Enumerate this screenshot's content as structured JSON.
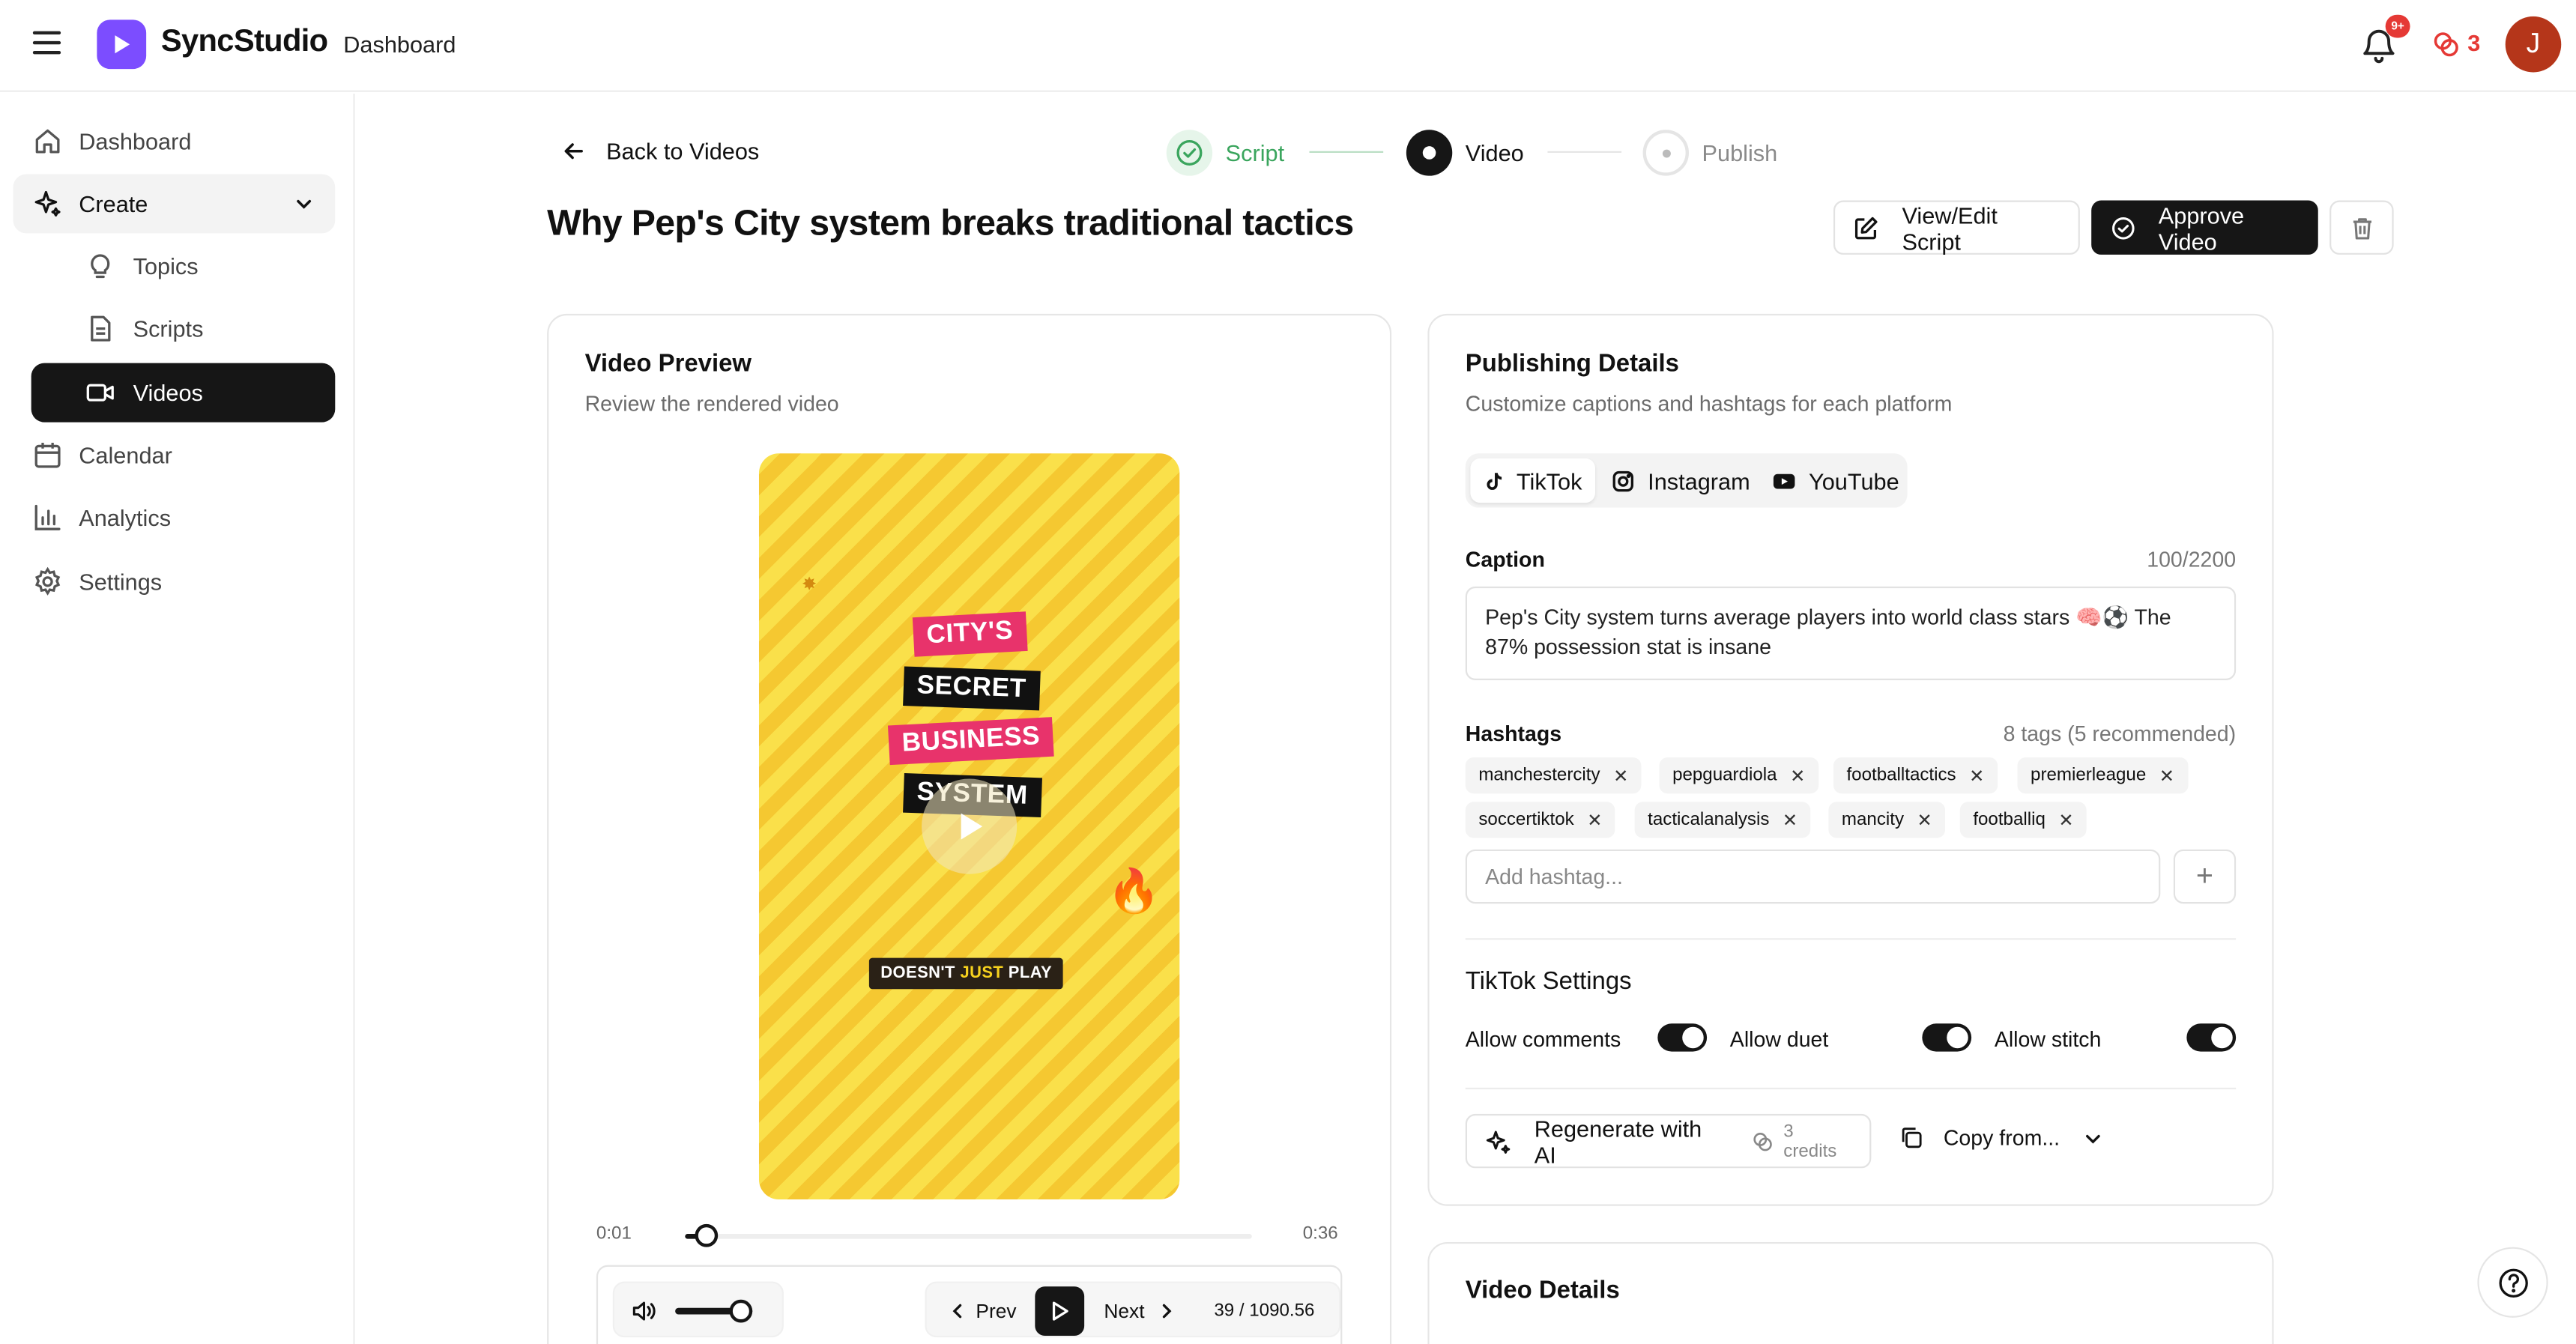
{
  "app": {
    "brand": "SyncStudio",
    "breadcrumb": "Dashboard"
  },
  "header": {
    "notification_badge": "9+",
    "credits": "3",
    "avatar_initial": "J"
  },
  "colors": {
    "brand": "#7c4dff",
    "dark": "#161616",
    "alert": "#e53935",
    "success": "#3aa55d",
    "avatar": "#b5361a"
  },
  "sidebar": {
    "items": [
      {
        "label": "Dashboard",
        "icon": "home-icon"
      },
      {
        "label": "Create",
        "icon": "sparkles-icon"
      },
      {
        "label": "Topics",
        "icon": "lightbulb-icon"
      },
      {
        "label": "Scripts",
        "icon": "file-icon"
      },
      {
        "label": "Videos",
        "icon": "video-icon"
      },
      {
        "label": "Calendar",
        "icon": "calendar-icon"
      },
      {
        "label": "Analytics",
        "icon": "chart-icon"
      },
      {
        "label": "Settings",
        "icon": "gear-icon"
      }
    ]
  },
  "nav": {
    "back_label": "Back to Videos"
  },
  "steps": [
    {
      "label": "Script",
      "state": "done"
    },
    {
      "label": "Video",
      "state": "current"
    },
    {
      "label": "Publish",
      "state": "pending"
    }
  ],
  "page": {
    "title": "Why Pep's City system breaks traditional tactics"
  },
  "actions": {
    "view_edit": "View/Edit Script",
    "approve": "Approve Video"
  },
  "preview": {
    "title": "Video Preview",
    "subtitle": "Review the rendered video",
    "overlay_lines": [
      "CITY'S",
      "SECRET",
      "BUSINESS",
      "SYSTEM"
    ],
    "caption_parts": [
      "DOESN'T ",
      "JUST",
      " PLAY"
    ],
    "current_time": "0:01",
    "duration": "0:36",
    "progress": 0.028,
    "volume": 0.85,
    "prev_label": "Prev",
    "next_label": "Next",
    "frame_counter": "39 / 1090.56"
  },
  "publishing": {
    "title": "Publishing Details",
    "subtitle": "Customize captions and hashtags for each platform",
    "tabs": [
      "TikTok",
      "Instagram",
      "YouTube"
    ],
    "active_tab": "TikTok",
    "caption_label": "Caption",
    "caption_count": "100/2200",
    "caption_text": "Pep's City system turns average players into world class stars 🧠⚽ The 87% possession stat is insane",
    "hashtags_label": "Hashtags",
    "hashtags_meta": "8 tags (5 recommended)",
    "hashtags": [
      "manchestercity",
      "pepguardiola",
      "footballtactics",
      "premierleague",
      "soccertiktok",
      "tacticalanalysis",
      "mancity",
      "footballiq"
    ],
    "hashtag_placeholder": "Add hashtag...",
    "settings_title": "TikTok Settings",
    "settings": [
      {
        "label": "Allow comments",
        "on": true
      },
      {
        "label": "Allow duet",
        "on": true
      },
      {
        "label": "Allow stitch",
        "on": true
      }
    ],
    "regenerate_label": "Regenerate with AI",
    "regenerate_cost": "3 credits",
    "copy_label": "Copy from..."
  },
  "details": {
    "title": "Video Details"
  }
}
